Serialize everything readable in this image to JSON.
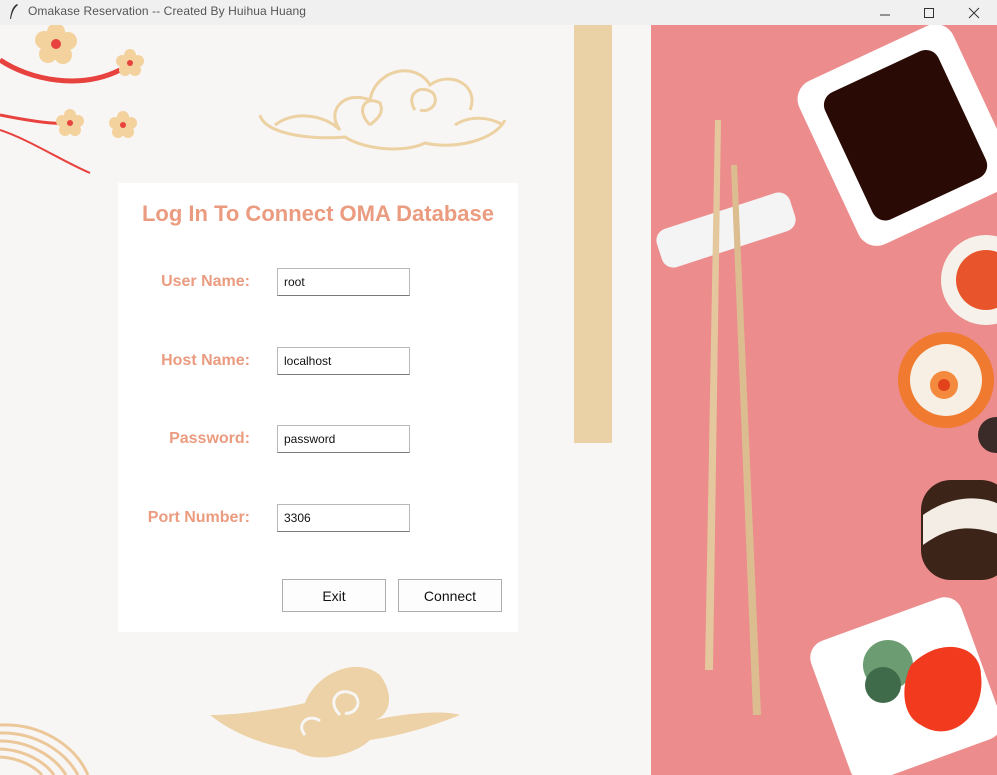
{
  "window": {
    "title": "Omakase Reservation -- Created By Huihua Huang",
    "minimize_icon": "minimize-icon",
    "maximize_icon": "maximize-icon",
    "close_icon": "close-icon"
  },
  "login": {
    "title": "Log In To Connect OMA Database",
    "fields": [
      {
        "label": "User Name:",
        "value": "root"
      },
      {
        "label": "Host Name:",
        "value": "localhost"
      },
      {
        "label": "Password:",
        "value": "password"
      },
      {
        "label": "Port Number:",
        "value": "3306"
      }
    ],
    "exit_label": "Exit",
    "connect_label": "Connect"
  },
  "colors": {
    "accent": "#eb9b7f",
    "tan": "#ebd1a6",
    "photo_bg": "#ec8c8c",
    "page_bg": "#f8f6f4"
  }
}
